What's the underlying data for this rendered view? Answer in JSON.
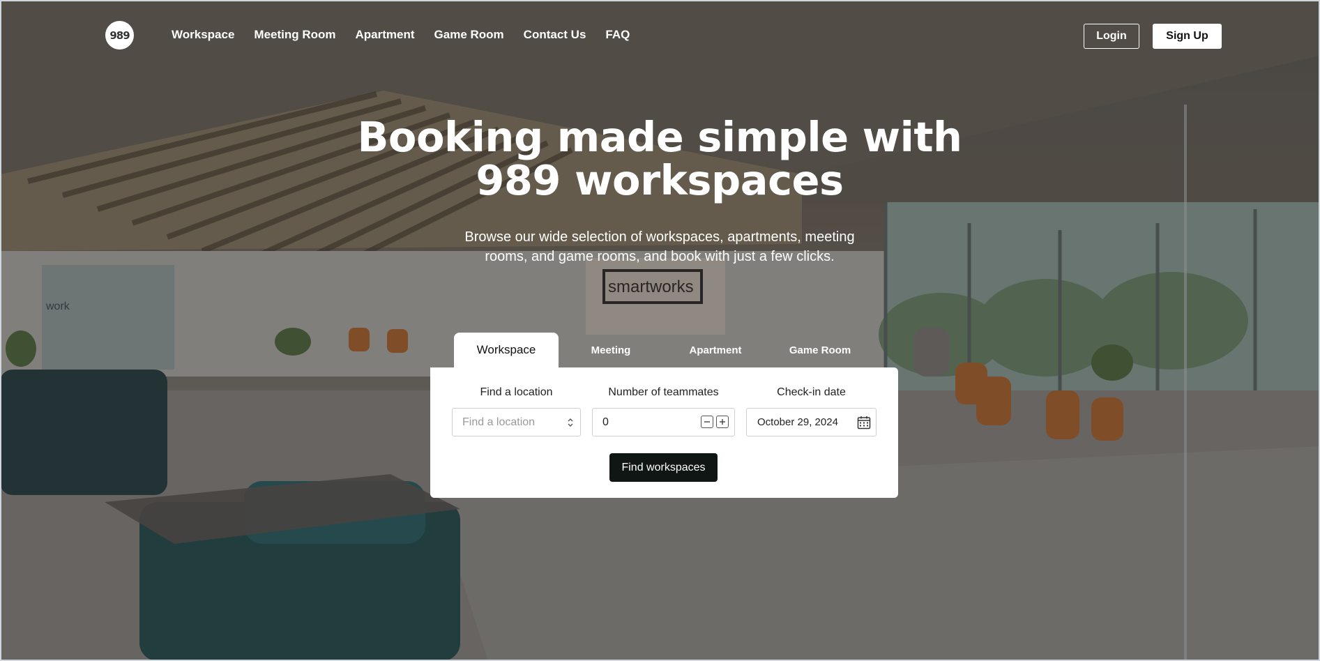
{
  "brand": {
    "logo_text": "989"
  },
  "nav": {
    "links": [
      "Workspace",
      "Meeting Room",
      "Apartment",
      "Game Room",
      "Contact Us",
      "FAQ"
    ],
    "login_label": "Login",
    "signup_label": "Sign Up"
  },
  "hero": {
    "title_line1": "Booking made simple with",
    "title_line2": "989 workspaces",
    "subtitle_line1": "Browse our wide selection of workspaces, apartments, meeting",
    "subtitle_line2": "rooms, and game rooms, and book with just a few clicks.",
    "background_sign_text": "smartworks",
    "background_wall_text": "work"
  },
  "search": {
    "tabs": [
      "Workspace",
      "Meeting",
      "Apartment",
      "Game Room"
    ],
    "active_tab": "Workspace",
    "location": {
      "label": "Find a location",
      "placeholder": "Find a location"
    },
    "teammates": {
      "label": "Number of teammates",
      "value": "0"
    },
    "checkin": {
      "label": "Check-in date",
      "value": "October 29, 2024"
    },
    "submit_label": "Find workspaces"
  },
  "colors": {
    "primary_button": "#101614",
    "text_on_dark": "#ffffff",
    "card_bg": "#ffffff"
  },
  "icons": {
    "location_select": "chevron-up-down-icon",
    "decrement": "minus-square-icon",
    "increment": "plus-square-icon",
    "date": "calendar-icon"
  }
}
